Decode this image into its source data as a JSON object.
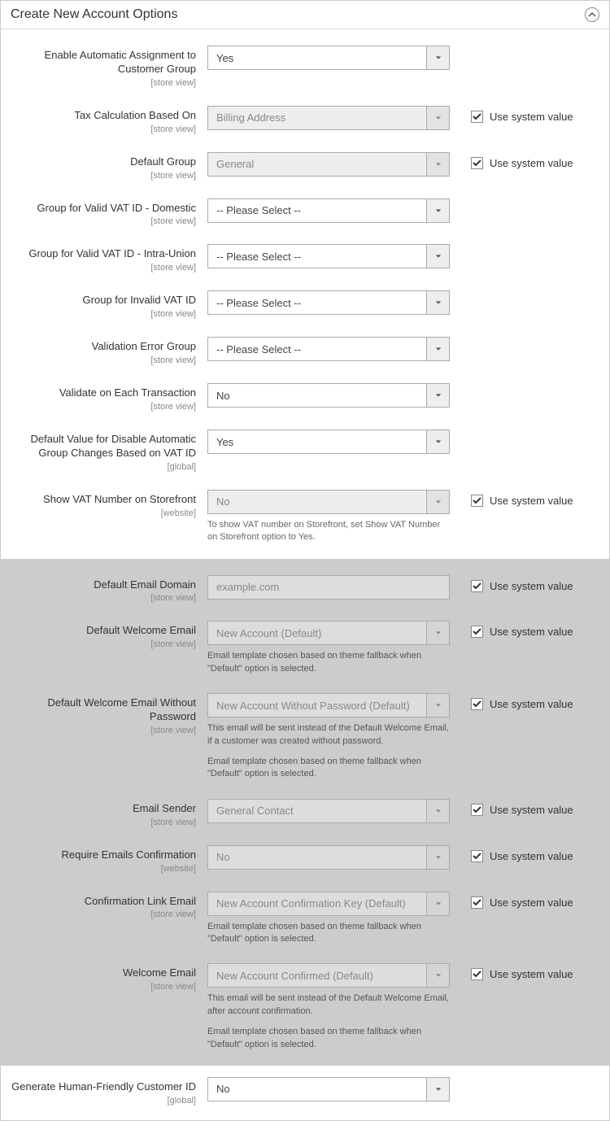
{
  "section_title": "Create New Account Options",
  "use_system_value_label": "Use system value",
  "scopes": {
    "store_view": "[store view]",
    "global": "[global]",
    "website": "[website]"
  },
  "fields": {
    "auto_assign": {
      "label": "Enable Automatic Assignment to Customer Group",
      "value": "Yes"
    },
    "tax_calc": {
      "label": "Tax Calculation Based On",
      "value": "Billing Address"
    },
    "default_group": {
      "label": "Default Group",
      "value": "General"
    },
    "valid_vat_domestic": {
      "label": "Group for Valid VAT ID - Domestic",
      "value": "-- Please Select --"
    },
    "valid_vat_intra": {
      "label": "Group for Valid VAT ID - Intra-Union",
      "value": "-- Please Select --"
    },
    "invalid_vat": {
      "label": "Group for Invalid VAT ID",
      "value": "-- Please Select --"
    },
    "validation_error": {
      "label": "Validation Error Group",
      "value": "-- Please Select --"
    },
    "validate_each": {
      "label": "Validate on Each Transaction",
      "value": "No"
    },
    "disable_auto_vat": {
      "label": "Default Value for Disable Automatic Group Changes Based on VAT ID",
      "value": "Yes"
    },
    "show_vat": {
      "label": "Show VAT Number on Storefront",
      "value": "No",
      "comment": "To show VAT number on Storefront, set Show VAT Number on Storefront option to Yes."
    },
    "email_domain": {
      "label": "Default Email Domain",
      "value": "example.com"
    },
    "welcome_email": {
      "label": "Default Welcome Email",
      "value": "New Account (Default)",
      "comment": "Email template chosen based on theme fallback when \"Default\" option is selected."
    },
    "welcome_no_pw": {
      "label": "Default Welcome Email Without Password",
      "value": "New Account Without Password (Default)",
      "comment1": "This email will be sent instead of the Default Welcome Email, if a customer was created without password.",
      "comment2": "Email template chosen based on theme fallback when \"Default\" option is selected."
    },
    "email_sender": {
      "label": "Email Sender",
      "value": "General Contact"
    },
    "require_confirm": {
      "label": "Require Emails Confirmation",
      "value": "No"
    },
    "confirm_link": {
      "label": "Confirmation Link Email",
      "value": "New Account Confirmation Key (Default)",
      "comment": "Email template chosen based on theme fallback when \"Default\" option is selected."
    },
    "welcome_email2": {
      "label": "Welcome Email",
      "value": "New Account Confirmed (Default)",
      "comment1": "This email will be sent instead of the Default Welcome Email, after account confirmation.",
      "comment2": "Email template chosen based on theme fallback when \"Default\" option is selected."
    },
    "friendly_id": {
      "label": "Generate Human-Friendly Customer ID",
      "value": "No"
    }
  }
}
